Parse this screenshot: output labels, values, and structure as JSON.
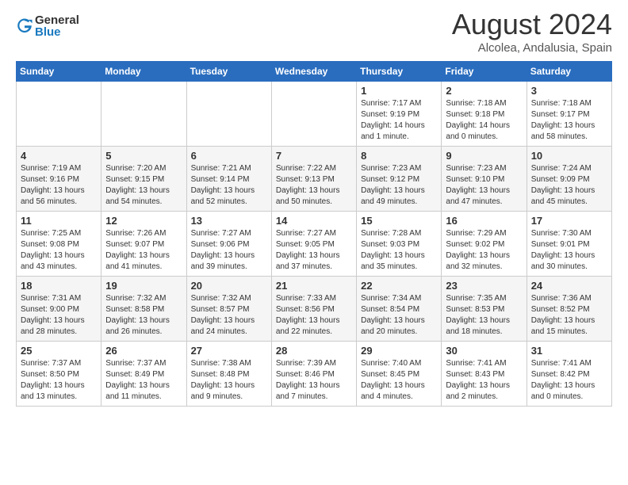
{
  "header": {
    "logo_general": "General",
    "logo_blue": "Blue",
    "main_title": "August 2024",
    "subtitle": "Alcolea, Andalusia, Spain"
  },
  "calendar": {
    "days_of_week": [
      "Sunday",
      "Monday",
      "Tuesday",
      "Wednesday",
      "Thursday",
      "Friday",
      "Saturday"
    ],
    "weeks": [
      {
        "days": [
          {
            "number": "",
            "info": ""
          },
          {
            "number": "",
            "info": ""
          },
          {
            "number": "",
            "info": ""
          },
          {
            "number": "",
            "info": ""
          },
          {
            "number": "1",
            "info": "Sunrise: 7:17 AM\nSunset: 9:19 PM\nDaylight: 14 hours\nand 1 minute."
          },
          {
            "number": "2",
            "info": "Sunrise: 7:18 AM\nSunset: 9:18 PM\nDaylight: 14 hours\nand 0 minutes."
          },
          {
            "number": "3",
            "info": "Sunrise: 7:18 AM\nSunset: 9:17 PM\nDaylight: 13 hours\nand 58 minutes."
          }
        ]
      },
      {
        "days": [
          {
            "number": "4",
            "info": "Sunrise: 7:19 AM\nSunset: 9:16 PM\nDaylight: 13 hours\nand 56 minutes."
          },
          {
            "number": "5",
            "info": "Sunrise: 7:20 AM\nSunset: 9:15 PM\nDaylight: 13 hours\nand 54 minutes."
          },
          {
            "number": "6",
            "info": "Sunrise: 7:21 AM\nSunset: 9:14 PM\nDaylight: 13 hours\nand 52 minutes."
          },
          {
            "number": "7",
            "info": "Sunrise: 7:22 AM\nSunset: 9:13 PM\nDaylight: 13 hours\nand 50 minutes."
          },
          {
            "number": "8",
            "info": "Sunrise: 7:23 AM\nSunset: 9:12 PM\nDaylight: 13 hours\nand 49 minutes."
          },
          {
            "number": "9",
            "info": "Sunrise: 7:23 AM\nSunset: 9:10 PM\nDaylight: 13 hours\nand 47 minutes."
          },
          {
            "number": "10",
            "info": "Sunrise: 7:24 AM\nSunset: 9:09 PM\nDaylight: 13 hours\nand 45 minutes."
          }
        ]
      },
      {
        "days": [
          {
            "number": "11",
            "info": "Sunrise: 7:25 AM\nSunset: 9:08 PM\nDaylight: 13 hours\nand 43 minutes."
          },
          {
            "number": "12",
            "info": "Sunrise: 7:26 AM\nSunset: 9:07 PM\nDaylight: 13 hours\nand 41 minutes."
          },
          {
            "number": "13",
            "info": "Sunrise: 7:27 AM\nSunset: 9:06 PM\nDaylight: 13 hours\nand 39 minutes."
          },
          {
            "number": "14",
            "info": "Sunrise: 7:27 AM\nSunset: 9:05 PM\nDaylight: 13 hours\nand 37 minutes."
          },
          {
            "number": "15",
            "info": "Sunrise: 7:28 AM\nSunset: 9:03 PM\nDaylight: 13 hours\nand 35 minutes."
          },
          {
            "number": "16",
            "info": "Sunrise: 7:29 AM\nSunset: 9:02 PM\nDaylight: 13 hours\nand 32 minutes."
          },
          {
            "number": "17",
            "info": "Sunrise: 7:30 AM\nSunset: 9:01 PM\nDaylight: 13 hours\nand 30 minutes."
          }
        ]
      },
      {
        "days": [
          {
            "number": "18",
            "info": "Sunrise: 7:31 AM\nSunset: 9:00 PM\nDaylight: 13 hours\nand 28 minutes."
          },
          {
            "number": "19",
            "info": "Sunrise: 7:32 AM\nSunset: 8:58 PM\nDaylight: 13 hours\nand 26 minutes."
          },
          {
            "number": "20",
            "info": "Sunrise: 7:32 AM\nSunset: 8:57 PM\nDaylight: 13 hours\nand 24 minutes."
          },
          {
            "number": "21",
            "info": "Sunrise: 7:33 AM\nSunset: 8:56 PM\nDaylight: 13 hours\nand 22 minutes."
          },
          {
            "number": "22",
            "info": "Sunrise: 7:34 AM\nSunset: 8:54 PM\nDaylight: 13 hours\nand 20 minutes."
          },
          {
            "number": "23",
            "info": "Sunrise: 7:35 AM\nSunset: 8:53 PM\nDaylight: 13 hours\nand 18 minutes."
          },
          {
            "number": "24",
            "info": "Sunrise: 7:36 AM\nSunset: 8:52 PM\nDaylight: 13 hours\nand 15 minutes."
          }
        ]
      },
      {
        "days": [
          {
            "number": "25",
            "info": "Sunrise: 7:37 AM\nSunset: 8:50 PM\nDaylight: 13 hours\nand 13 minutes."
          },
          {
            "number": "26",
            "info": "Sunrise: 7:37 AM\nSunset: 8:49 PM\nDaylight: 13 hours\nand 11 minutes."
          },
          {
            "number": "27",
            "info": "Sunrise: 7:38 AM\nSunset: 8:48 PM\nDaylight: 13 hours\nand 9 minutes."
          },
          {
            "number": "28",
            "info": "Sunrise: 7:39 AM\nSunset: 8:46 PM\nDaylight: 13 hours\nand 7 minutes."
          },
          {
            "number": "29",
            "info": "Sunrise: 7:40 AM\nSunset: 8:45 PM\nDaylight: 13 hours\nand 4 minutes."
          },
          {
            "number": "30",
            "info": "Sunrise: 7:41 AM\nSunset: 8:43 PM\nDaylight: 13 hours\nand 2 minutes."
          },
          {
            "number": "31",
            "info": "Sunrise: 7:41 AM\nSunset: 8:42 PM\nDaylight: 13 hours\nand 0 minutes."
          }
        ]
      }
    ]
  }
}
